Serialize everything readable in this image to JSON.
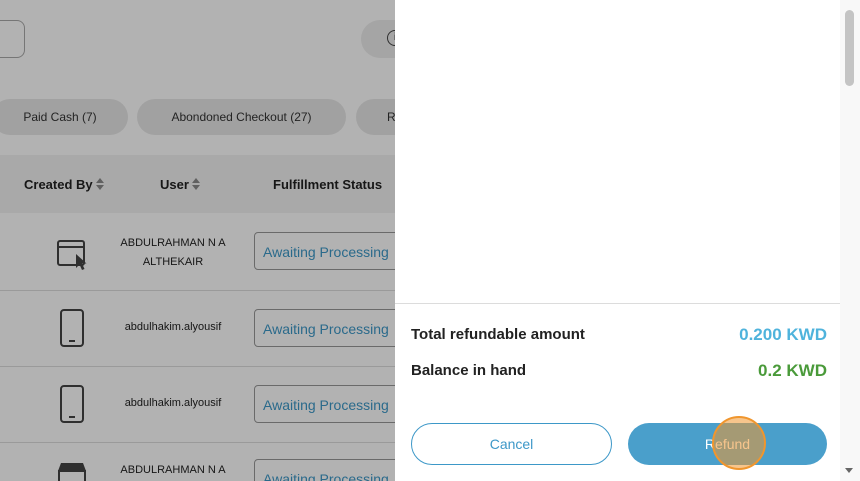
{
  "filters": {
    "chips": [
      "Paid Cash (7)",
      "Abondoned Checkout (27)",
      "R"
    ]
  },
  "table": {
    "headers": {
      "created_by": "Created By",
      "user": "User",
      "fulfillment_status": "Fulfillment Status"
    },
    "rows": [
      {
        "created_by_icon": "browser-window-icon",
        "user": "ABDULRAHMAN N A ALTHEKAIR",
        "status": "Awaiting Processing"
      },
      {
        "created_by_icon": "mobile-phone-icon",
        "user": "abdulhakim.alyousif",
        "status": "Awaiting Processing"
      },
      {
        "created_by_icon": "mobile-phone-icon",
        "user": "abdulhakim.alyousif",
        "status": "Awaiting Processing"
      },
      {
        "created_by_icon": "store-icon",
        "user": "ABDULRAHMAN N A",
        "status": "Awaiting Processing"
      }
    ]
  },
  "refund_panel": {
    "total_label": "Total refundable amount",
    "total_value": "0.200 KWD",
    "balance_label": "Balance in hand",
    "balance_value": "0.2 KWD",
    "cancel_label": "Cancel",
    "refund_label": "Refund"
  },
  "colors": {
    "accent": "#3d98c8",
    "total_value": "#4fb3dc",
    "balance_value": "#4a9a3a",
    "click_highlight": "#f0962e"
  }
}
